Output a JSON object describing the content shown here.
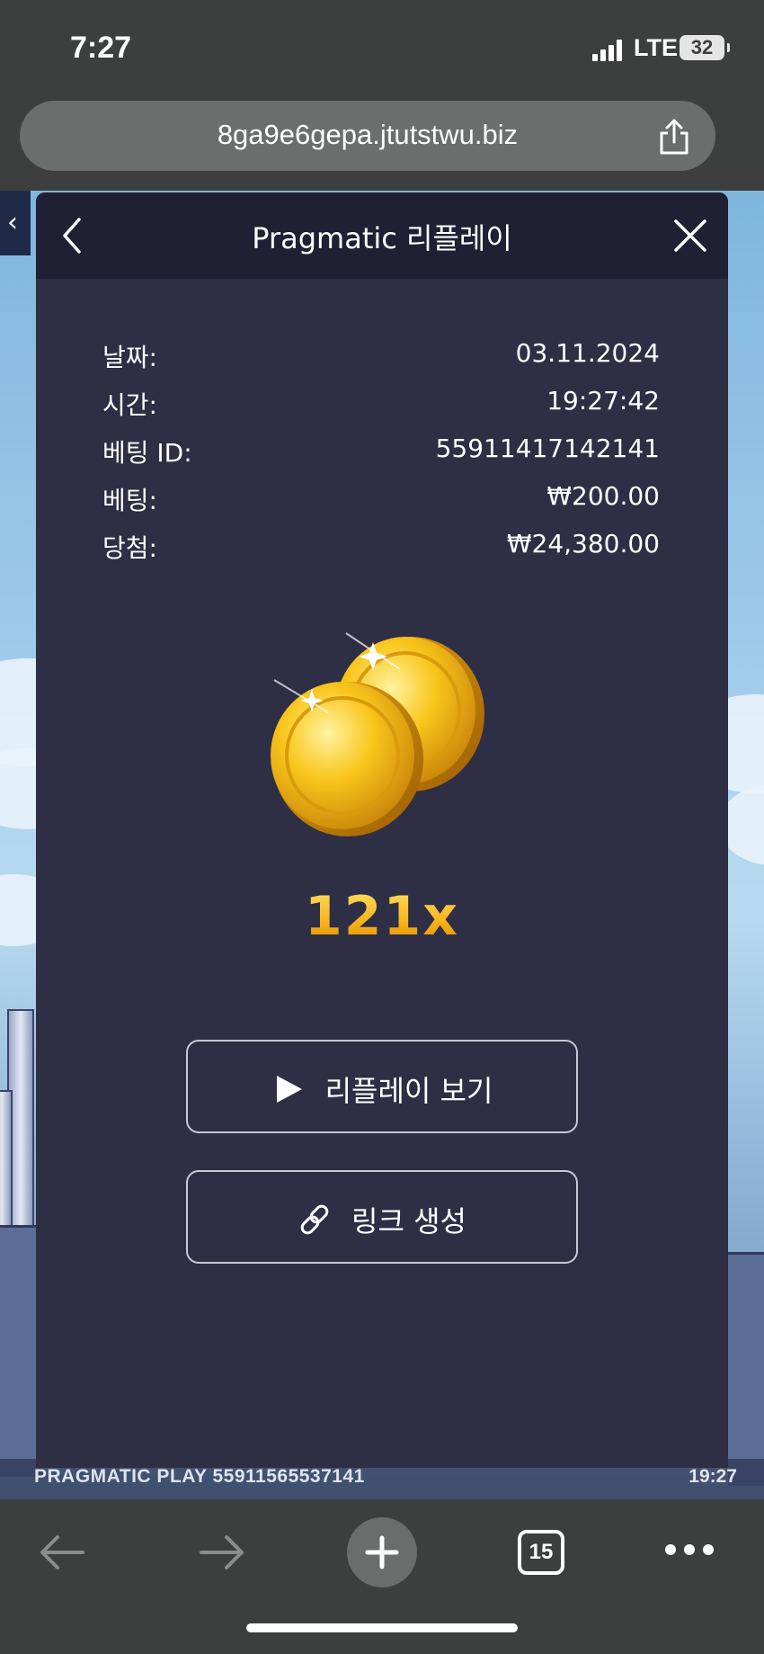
{
  "status_bar": {
    "time": "7:27",
    "network": "LTE",
    "battery": "32"
  },
  "browser": {
    "url": "8ga9e6gepa.jtutstwu.biz",
    "tab_count": "15"
  },
  "modal": {
    "title": "Pragmatic 리플레이",
    "details": [
      {
        "label": "날짜:",
        "value": "03.11.2024"
      },
      {
        "label": "시간:",
        "value": "19:27:42"
      },
      {
        "label": "베팅 ID:",
        "value": "55911417142141"
      },
      {
        "label": "베팅:",
        "value": "₩200.00"
      },
      {
        "label": "당첨:",
        "value": "₩24,380.00"
      }
    ],
    "multiplier": "121x",
    "replay_button": "리플레이 보기",
    "link_button": "링크 생성"
  },
  "game_footer": {
    "left": "PRAGMATIC PLAY  55911565537141",
    "right": "19:27"
  },
  "colors": {
    "modal_bg": "#2e2f45",
    "header_bg": "#1f2033",
    "coin_gold": "#f5b716"
  }
}
